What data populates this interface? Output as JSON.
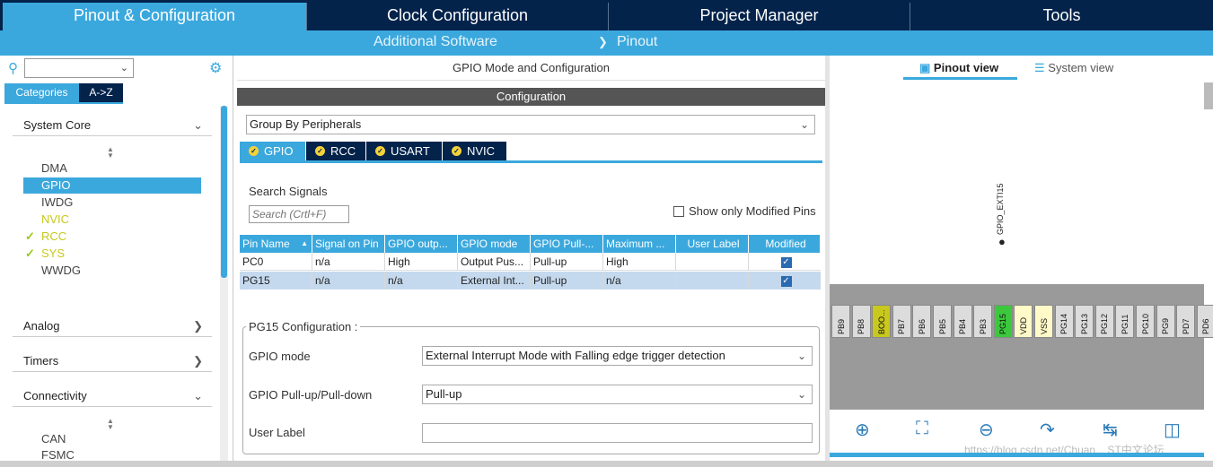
{
  "top_tabs": [
    {
      "label": "Pinout & Configuration"
    },
    {
      "label": "Clock Configuration"
    },
    {
      "label": "Project Manager"
    },
    {
      "label": "Tools"
    }
  ],
  "sub_bar": {
    "additional_software": "Additional Software",
    "pinout": "Pinout"
  },
  "left": {
    "search_placeholder": "",
    "tab_categories": "Categories",
    "tab_az": "A->Z",
    "system_core": {
      "label": "System Core",
      "items": [
        {
          "label": "DMA"
        },
        {
          "label": "GPIO"
        },
        {
          "label": "IWDG"
        },
        {
          "label": "NVIC"
        },
        {
          "label": "RCC"
        },
        {
          "label": "SYS"
        },
        {
          "label": "WWDG"
        }
      ]
    },
    "analog": "Analog",
    "timers": "Timers",
    "connectivity": {
      "label": "Connectivity",
      "items": [
        {
          "label": "CAN"
        },
        {
          "label": "FSMC"
        }
      ]
    }
  },
  "middle": {
    "title": "GPIO Mode and Configuration",
    "config_header": "Configuration",
    "group_select": "Group By Peripherals",
    "peripheral_tabs": [
      {
        "label": "GPIO"
      },
      {
        "label": "RCC"
      },
      {
        "label": "USART"
      },
      {
        "label": "NVIC"
      }
    ],
    "search_signals_label": "Search Signals",
    "search_placeholder": "Search (Crtl+F)",
    "show_modified_label": "Show only Modified Pins",
    "table": {
      "headers": [
        "Pin Name",
        "Signal on Pin",
        "GPIO outp...",
        "GPIO mode",
        "GPIO Pull-...",
        "Maximum ...",
        "User Label",
        "Modified"
      ],
      "rows": [
        [
          "PC0",
          "n/a",
          "High",
          "Output Pus...",
          "Pull-up",
          "High",
          "",
          "✓"
        ],
        [
          "PG15",
          "n/a",
          "n/a",
          "External Int...",
          "Pull-up",
          "n/a",
          "",
          "✓"
        ]
      ]
    },
    "pin_config": {
      "legend": "PG15 Configuration :",
      "gpio_mode_label": "GPIO mode",
      "gpio_mode_value": "External Interrupt Mode with Falling edge trigger detection",
      "pull_label": "GPIO Pull-up/Pull-down",
      "pull_value": "Pull-up",
      "user_label_label": "User Label",
      "user_label_value": ""
    }
  },
  "right": {
    "pinout_view": "Pinout view",
    "system_view": "System view",
    "pin_signal_label": "GPIO_EXTI15",
    "pins": [
      "PB9",
      "PB8",
      "BOO...",
      "PB7",
      "PB6",
      "PB5",
      "PB4",
      "PB3",
      "PG15",
      "VDD",
      "VSS",
      "PG14",
      "PG13",
      "PG12",
      "PG11",
      "PG10",
      "PG9",
      "PD7",
      "PD6"
    ],
    "watermark": "https://blog.csdn.net/Chuan... ST中文论坛"
  },
  "colors": {
    "navy": "#03234b",
    "blue": "#3ba8dd",
    "pin_green": "#3cc83c",
    "pin_yellow": "#c8c81e",
    "pin_power": "#fffac8"
  }
}
